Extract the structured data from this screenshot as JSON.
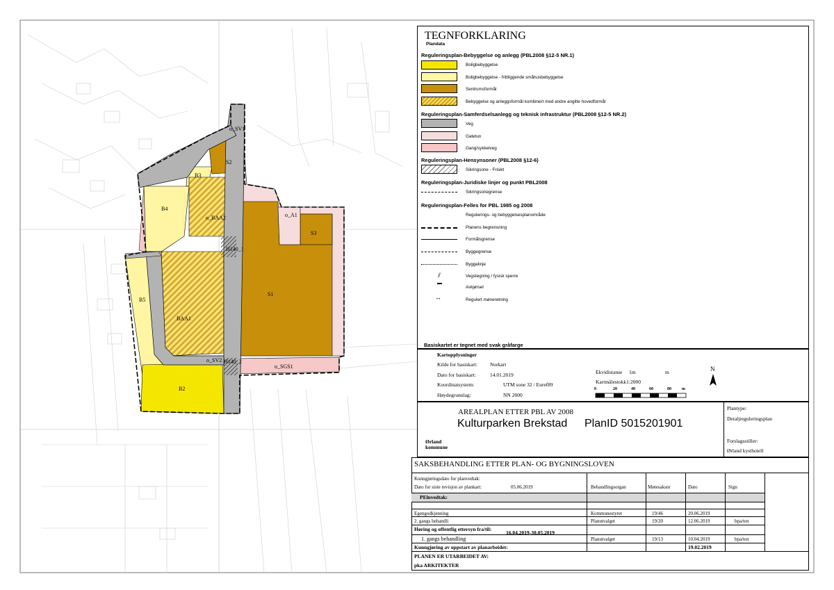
{
  "legend": {
    "title": "TEGNFORKLARING",
    "subtitle": "Plandata",
    "sections": [
      {
        "heading": "Reguleringsplan-Bebyggelse og anlegg (PBL2008 §12-5 NR.1)",
        "items": [
          {
            "label": "Boligbebyggelse",
            "color": "#f5e600"
          },
          {
            "label": "Boligbebyggelse - frittliggende småhusbebyggelse",
            "color": "#fff7a6"
          },
          {
            "label": "Sentrumsformål",
            "color": "#c8900a"
          },
          {
            "label": "Bebyggelse og anleggsformål kombinert med andre angitte hovedformål",
            "color": "hatch"
          }
        ]
      },
      {
        "heading": "Reguleringsplan-Samferdselsanlegg og teknisk infrastruktur (PBL2008 §12-5 NR.2)",
        "items": [
          {
            "label": "Veg",
            "color": "#b3b3b3"
          },
          {
            "label": "Gatetun",
            "color": "#f5dede"
          },
          {
            "label": "Gang/sykkelveg",
            "color": "#f8c6c6"
          }
        ]
      },
      {
        "heading": "Reguleringsplan-Hensynsoner (PBL2008 §12-6)",
        "items": [
          {
            "label": "Sikringsone - Frisikt",
            "color": "sikring"
          }
        ]
      },
      {
        "heading": "Reguleringsplan-Juridiske linjer og punkt PBL2008",
        "items": [
          {
            "label": "Sikringsonegrense",
            "line": "dashdot"
          }
        ]
      },
      {
        "heading": "Reguleringsplan-Felles for  PBL 1985 og 2008",
        "items": [
          {
            "label": "Regulerings- og bebyggelsesplanområde",
            "line": "none"
          },
          {
            "label": "Planens begrensning",
            "line": "bold-dash"
          },
          {
            "label": "Formålsgrense",
            "line": "solid"
          },
          {
            "label": "Byggegrense",
            "line": "dash"
          },
          {
            "label": "Byggelinje",
            "line": "fine-dash"
          },
          {
            "label": "Vegstegning / fysisk sperre",
            "line": "sperre"
          },
          {
            "label": "Avkjørsel",
            "line": "avkjorsel"
          },
          {
            "label": "Regulert møneretning",
            "line": "mone"
          }
        ]
      }
    ],
    "basis_note": "Basiskartet er tegnet med svak gråfarge"
  },
  "map_info": {
    "heading": "Kartopplysninger",
    "rows": [
      {
        "label": "Kilde for basiskart:",
        "value": "Norkart"
      },
      {
        "label": "Dato for basiskart:",
        "value": "14.01.2019"
      },
      {
        "label": "Koordinatsystem:",
        "value": "UTM sone 32 / Euref89"
      },
      {
        "label": "Høydegrunnlag:",
        "value": "NN 2000"
      }
    ],
    "ekvidistanse_label": "Ekvidistanse",
    "ekvidistanse_value": "1m",
    "ekvidistanse_unit": "m",
    "scale_label": "Kartmålestokk1:2000",
    "scale_ticks": [
      "0",
      "20",
      "40",
      "60",
      "80"
    ],
    "scale_unit": "m",
    "north": "N"
  },
  "title_block": {
    "heading": "AREALPLAN ETTER PBL AV 2008",
    "plan_name": "Kulturparken Brekstad",
    "plan_id": "PlanID 5015201901",
    "municipality_line1": "Ørland",
    "municipality_line2": "kommune",
    "plantype_label": "Plantype:",
    "plantype_value": "Detaljreguleringsplan",
    "proposer_label": "Forslagsstiller:",
    "proposer_value": "Ørland kysthotell"
  },
  "processing": {
    "heading": "SAKSBEHANDLING ETTER PLAN- OG BYGNINGSLOVEN",
    "kunngjoring_label": "Kunngjøringsdato for planvedtak:",
    "revision_label": "Dato for siste revisjon av plankart:",
    "revision_value": "05.06.2019",
    "columns": [
      "Behandlingsorgan",
      "Møtesaksnr",
      "Dato",
      "Sign"
    ],
    "vedtak_label": "PElnvedtak:",
    "rows": [
      {
        "label": "Egengodkjenning",
        "organ": "Kommunestyret",
        "sak": "19/46",
        "dato": "20.06.2019",
        "sign": ""
      },
      {
        "label": "2. gangs behandli",
        "organ": "Planutvalget",
        "sak": "19/20",
        "dato": "12.06.2019",
        "sign": "bpa/ten"
      },
      {
        "label": "Høring og offentlig ettersyn fra/til:",
        "period": "16.04.2019-30.05.2019",
        "organ": "",
        "sak": "",
        "dato": "",
        "sign": ""
      },
      {
        "label": "1.   gangs behandling",
        "organ": "Planutvalget",
        "sak": "19/13",
        "dato": "10.04.2019",
        "sign": "bpa/ten"
      },
      {
        "label": "Kunngjøring av oppstart av planarbeidet:",
        "organ": "",
        "sak": "",
        "dato": "19.02.2019",
        "sign": ""
      }
    ],
    "author_label": "PLANEN ER UTARBEIDET AV:",
    "author_value": "pka ARKITEKTER"
  },
  "map_labels": {
    "sv1": "o_SV1",
    "sv2": "o_SV2",
    "s2": "S2",
    "b3": "B3",
    "b4": "B4",
    "baa2": "o_BAA2",
    "a1": "o_A1",
    "s3": "S3",
    "h140_1": "H140_1",
    "h140_2": "H140_2",
    "b5": "B5",
    "baa1": "BAA1",
    "s1": "S1",
    "sgs1": "o_SGS1",
    "b2": "B2"
  }
}
